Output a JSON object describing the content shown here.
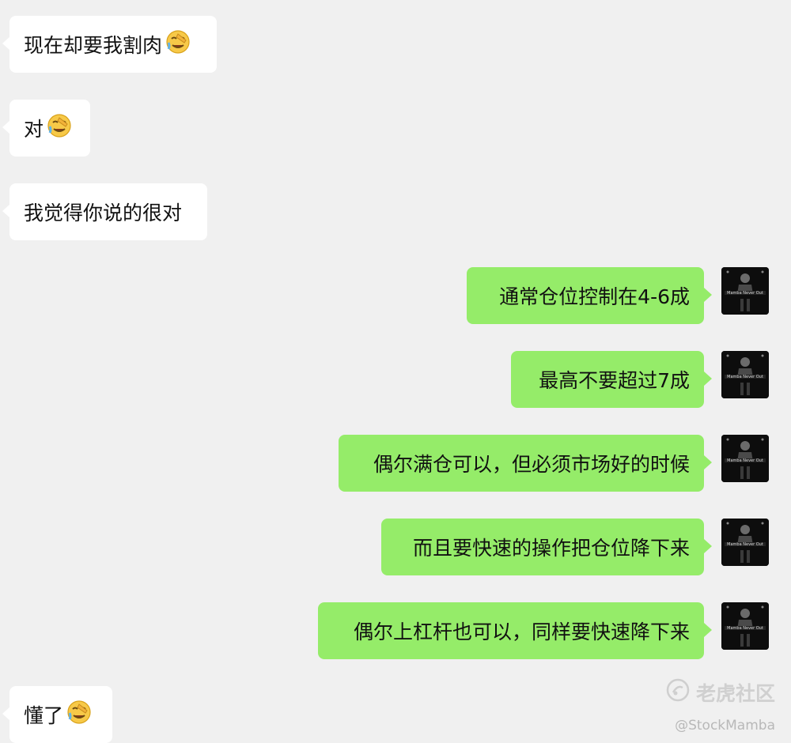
{
  "colors": {
    "background": "#f0f0f0",
    "incoming_bubble": "#ffffff",
    "outgoing_bubble": "#95ec69"
  },
  "messages": [
    {
      "side": "left",
      "text": "现在却要我割肉",
      "emoji": "face-with-hand-over-eye-crying"
    },
    {
      "side": "left",
      "text": "对",
      "emoji": "face-with-hand-over-eye-crying"
    },
    {
      "side": "left",
      "text": "我觉得你说的很对"
    },
    {
      "side": "right",
      "text": "通常仓位控制在4-6成"
    },
    {
      "side": "right",
      "text": "最高不要超过7成"
    },
    {
      "side": "right",
      "text": "偶尔满仓可以，但必须市场好的时候"
    },
    {
      "side": "right",
      "text": "而且要快速的操作把仓位降下来"
    },
    {
      "side": "right",
      "text": "偶尔上杠杆也可以，同样要快速降下来"
    },
    {
      "side": "left",
      "text": "懂了",
      "emoji": "face-with-hand-over-eye-crying"
    }
  ],
  "avatar": {
    "icon": "mamba-avatar-icon",
    "caption": "Mamba Never Out"
  },
  "watermark": {
    "brand": "老虎社区",
    "handle": "@StockMamba",
    "icon": "tiger-logo-icon"
  }
}
